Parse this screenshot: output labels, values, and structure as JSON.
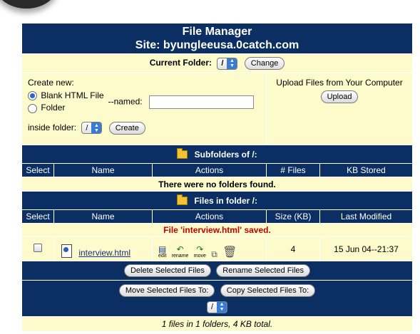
{
  "header": {
    "title": "File Manager",
    "site_label": "Site: byungleeusa.0catch.com"
  },
  "current_folder": {
    "label": "Current Folder:",
    "value": "/",
    "change_button": "Change"
  },
  "create": {
    "heading": "Create new:",
    "option_html": "Blank HTML File",
    "option_folder": "Folder",
    "named_label": "--named:",
    "name_value": "",
    "inside_label": "inside folder:",
    "inside_value": "/",
    "create_button": "Create"
  },
  "upload": {
    "heading": "Upload Files from Your Computer",
    "upload_button": "Upload"
  },
  "subfolders": {
    "title": "Subfolders of /:",
    "columns": [
      "Select",
      "Name",
      "Actions",
      "# Files",
      "KB Stored"
    ],
    "empty_message": "There were no folders found."
  },
  "files": {
    "title": "Files in folder /:",
    "columns": [
      "Select",
      "Name",
      "Actions",
      "Size (KB)",
      "Last Modified"
    ],
    "status_message": "File 'interview.html' saved.",
    "rows": [
      {
        "name": "interview.html",
        "size": "4",
        "modified": "15 Jun 04--21:37",
        "actions": [
          "edit",
          "rename",
          "move"
        ]
      }
    ]
  },
  "bulk": {
    "delete_button": "Delete Selected Files",
    "rename_button": "Rename Selected Files",
    "move_button": "Move Selected Files To:",
    "copy_button": "Copy Selected Files To:",
    "target_folder": "/"
  },
  "summary": "1 files in 1 folders, 4 KB total."
}
